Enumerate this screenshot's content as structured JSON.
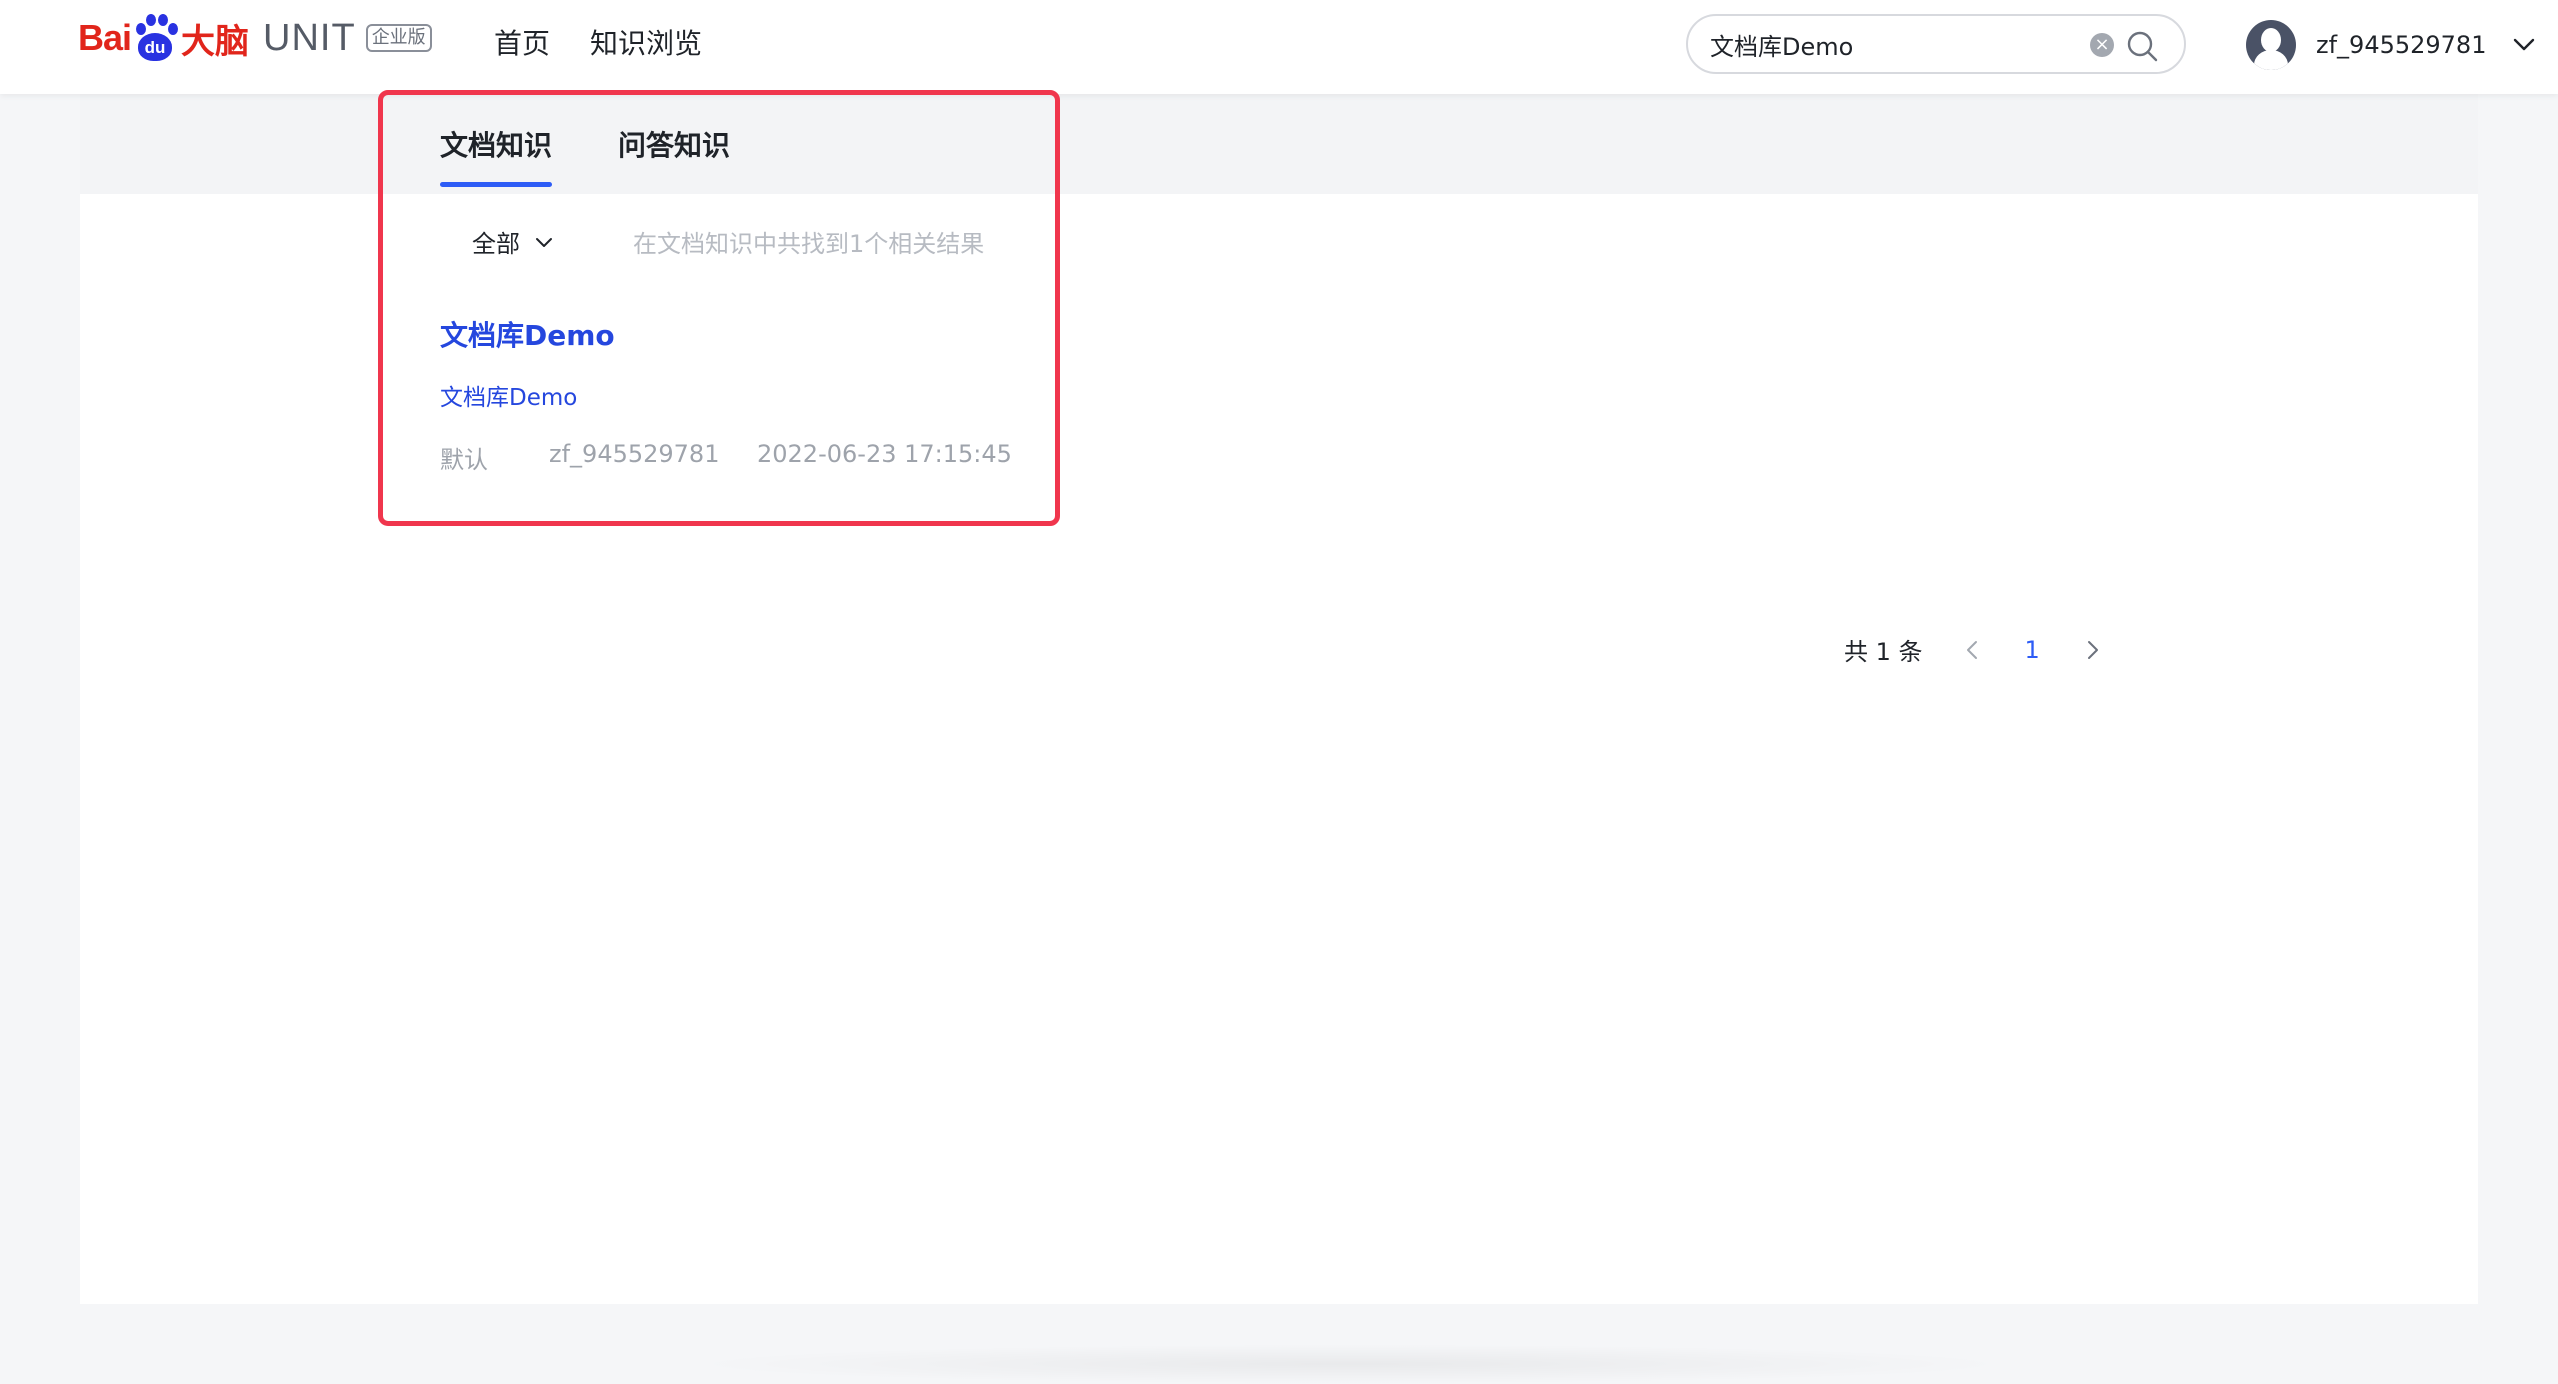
{
  "header": {
    "logo": {
      "bai": "Bai",
      "paw": "du",
      "danao": "大脑",
      "unit": "UNIT",
      "badge": "企业版"
    },
    "nav": [
      {
        "label": "首页"
      },
      {
        "label": "知识浏览"
      }
    ],
    "search": {
      "value": "文档库Demo",
      "placeholder": ""
    },
    "user": {
      "name": "zf_945529781"
    }
  },
  "main": {
    "tabs": [
      {
        "label": "文档知识",
        "active": true
      },
      {
        "label": "问答知识",
        "active": false
      }
    ],
    "filter": {
      "selected": "全部"
    },
    "result_count_text": "在文档知识中共找到1个相关结果",
    "results": [
      {
        "title": "文档库Demo",
        "subtitle": "文档库Demo",
        "category": "默认",
        "owner": "zf_945529781",
        "time": "2022-06-23 17:15:45"
      }
    ],
    "pagination": {
      "total_text": "共 1 条",
      "current_page": "1"
    }
  },
  "colors": {
    "brand_red": "#e1251b",
    "brand_blue": "#2932e1",
    "accent": "#2d5cf6",
    "link": "#2547de",
    "highlight": "#f0364d"
  },
  "icons": [
    "search-icon",
    "clear-icon",
    "chevron-down-icon",
    "avatar-icon",
    "chevron-left-icon",
    "chevron-right-icon"
  ]
}
